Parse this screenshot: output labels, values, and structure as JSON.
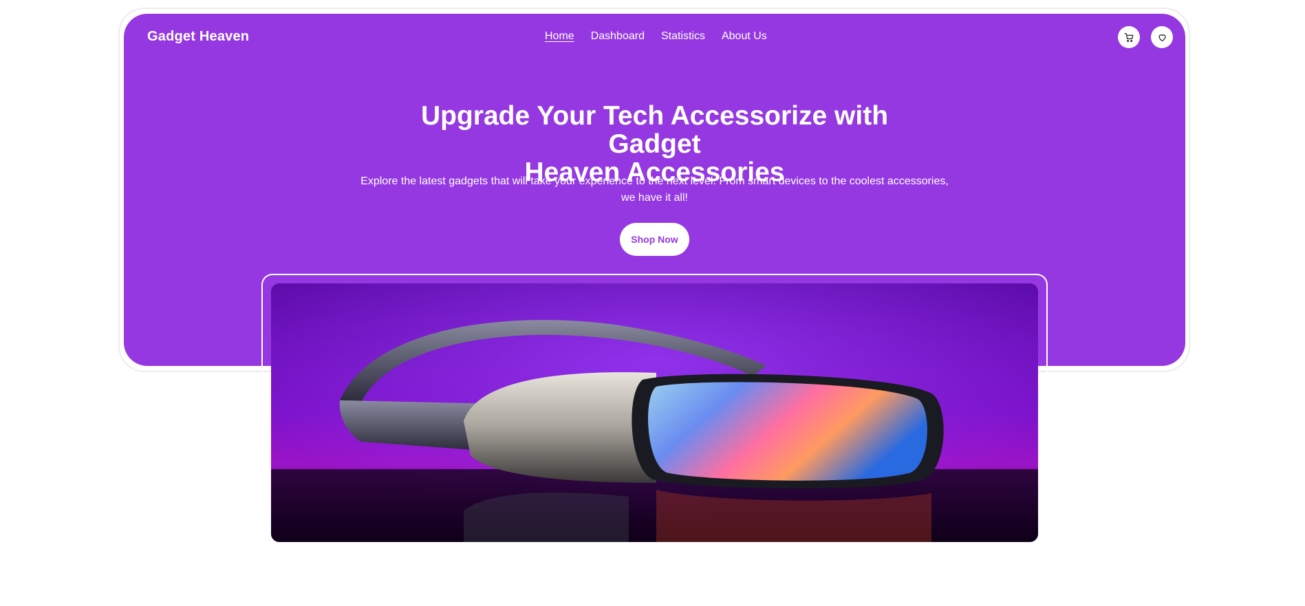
{
  "nav": {
    "brand": "Gadget Heaven",
    "links": [
      "Home",
      "Dashboard",
      "Statistics",
      "About Us"
    ],
    "active": "Home",
    "icons": [
      "cart-icon",
      "heart-icon"
    ]
  },
  "hero": {
    "title_line1": "Upgrade Your Tech Accessorize with Gadget",
    "title_line2": "Heaven Accessories",
    "subtitle_line1": "Explore the latest gadgets that will take your experience to the next level. From smart devices to the coolest accessories,",
    "subtitle_line2": "we have it all!",
    "cta_label": "Shop Now"
  },
  "banner": {
    "subject": "vr-headset-image"
  },
  "colors": {
    "primary": "#9538e2",
    "text_on_primary": "#ffffff"
  }
}
